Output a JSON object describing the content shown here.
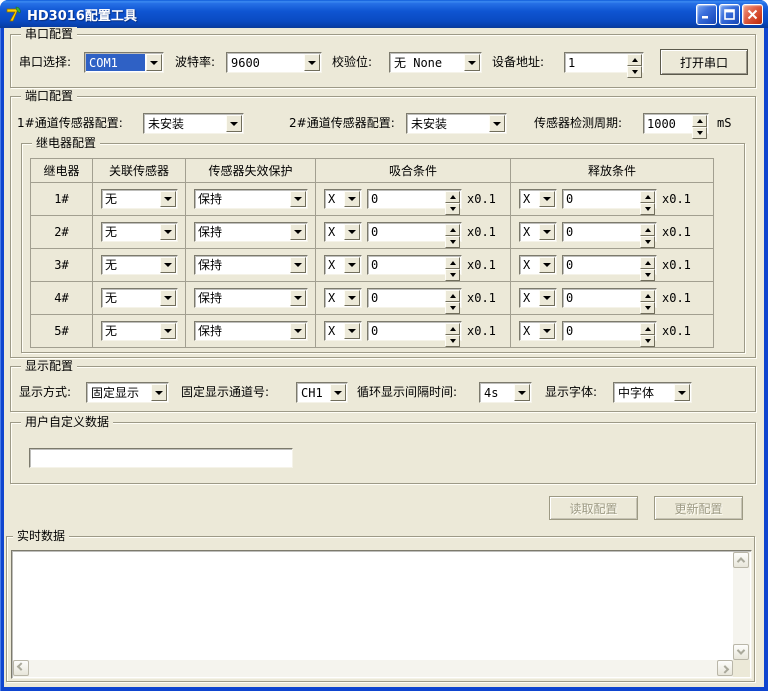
{
  "window": {
    "title": "HD3016配置工具"
  },
  "serial": {
    "group_label": "串口配置",
    "port_label": "串口选择:",
    "port_value": "COM1",
    "baud_label": "波特率:",
    "baud_value": "9600",
    "parity_label": "校验位:",
    "parity_value": "无 None",
    "addr_label": "设备地址:",
    "addr_value": "1",
    "open_button": "打开串口"
  },
  "port": {
    "group_label": "端口配置",
    "ch1_label": "1#通道传感器配置:",
    "ch1_value": "未安装",
    "ch2_label": "2#通道传感器配置:",
    "ch2_value": "未安装",
    "period_label": "传感器检测周期:",
    "period_value": "1000",
    "period_unit": "mS"
  },
  "relay": {
    "group_label": "继电器配置",
    "headers": [
      "继电器",
      "关联传感器",
      "传感器失效保护",
      "吸合条件",
      "释放条件"
    ],
    "multiplier": "x0.1",
    "rows": [
      {
        "id": "1#",
        "sensor": "无",
        "failsafe": "保持",
        "pull_op": "X",
        "pull_val": "0",
        "rel_op": "X",
        "rel_val": "0"
      },
      {
        "id": "2#",
        "sensor": "无",
        "failsafe": "保持",
        "pull_op": "X",
        "pull_val": "0",
        "rel_op": "X",
        "rel_val": "0"
      },
      {
        "id": "3#",
        "sensor": "无",
        "failsafe": "保持",
        "pull_op": "X",
        "pull_val": "0",
        "rel_op": "X",
        "rel_val": "0"
      },
      {
        "id": "4#",
        "sensor": "无",
        "failsafe": "保持",
        "pull_op": "X",
        "pull_val": "0",
        "rel_op": "X",
        "rel_val": "0"
      },
      {
        "id": "5#",
        "sensor": "无",
        "failsafe": "保持",
        "pull_op": "X",
        "pull_val": "0",
        "rel_op": "X",
        "rel_val": "0"
      }
    ]
  },
  "display": {
    "group_label": "显示配置",
    "mode_label": "显示方式:",
    "mode_value": "固定显示",
    "channel_label": "固定显示通道号:",
    "channel_value": "CH1",
    "interval_label": "循环显示间隔时间:",
    "interval_value": "4s",
    "font_label": "显示字体:",
    "font_value": "中字体"
  },
  "userdata": {
    "group_label": "用户自定义数据",
    "value": ""
  },
  "actions": {
    "read_button": "读取配置",
    "update_button": "更新配置"
  },
  "realtime": {
    "group_label": "实时数据",
    "content": ""
  }
}
